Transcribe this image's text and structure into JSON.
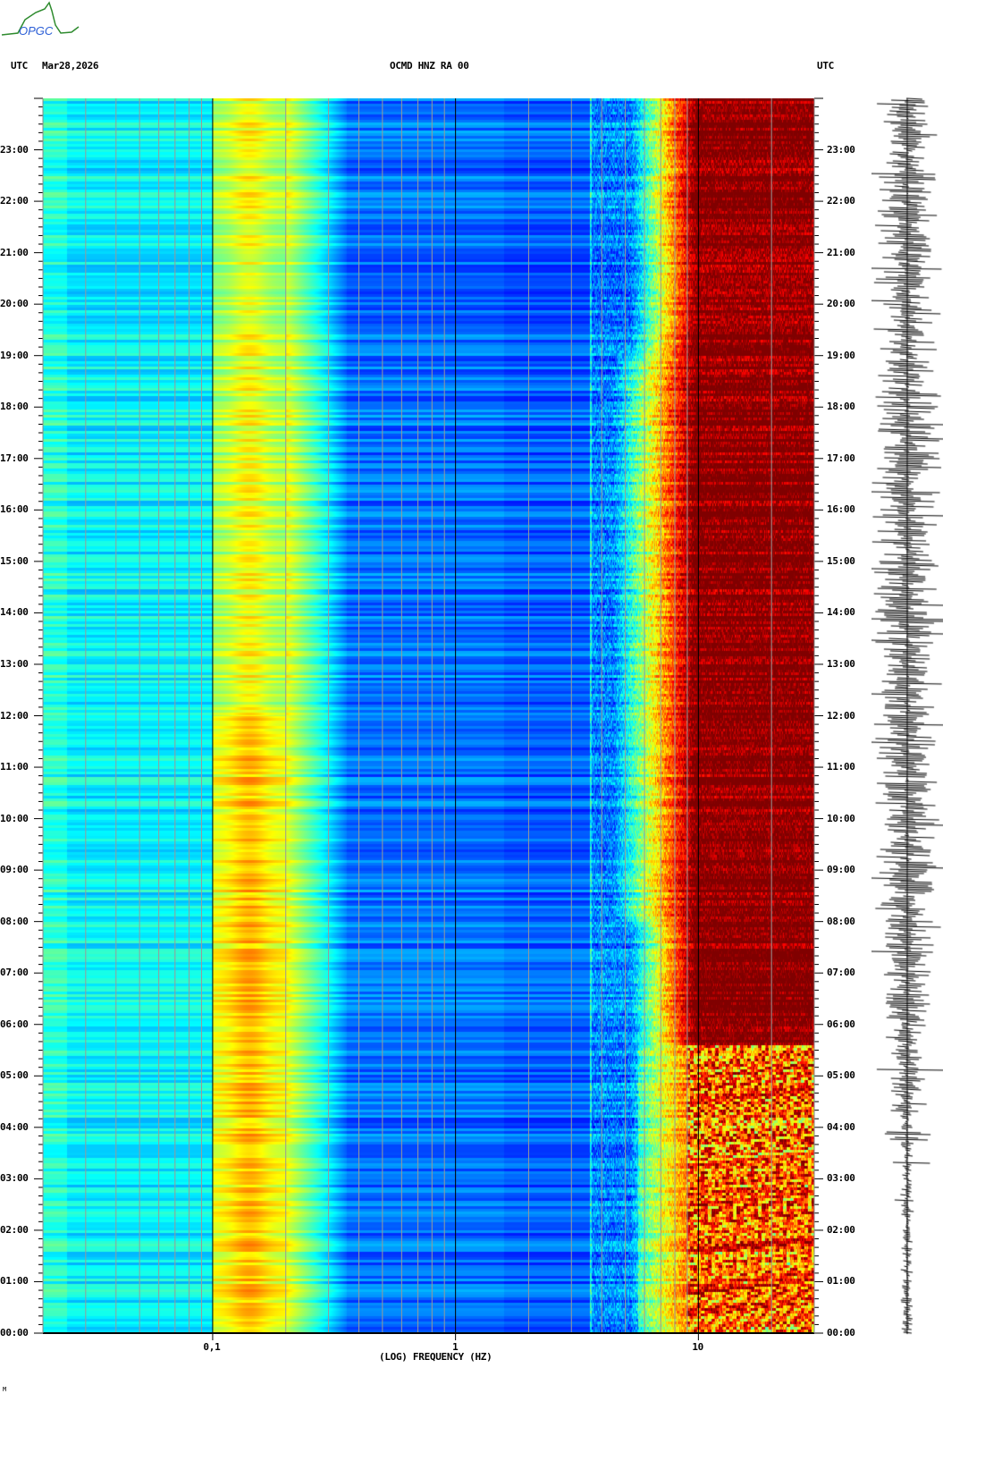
{
  "header": {
    "logo_text": "OPGC",
    "left_label": "UTC",
    "date": "Mar28,2026",
    "title": "OCMD HNZ RA 00",
    "right_label": "UTC"
  },
  "footer_mark": "M",
  "colors": {
    "low": "#00008f",
    "mid": "#00ffff",
    "high": "#ffff00",
    "max": "#800000"
  },
  "chart_data": {
    "type": "heatmap",
    "title": "OCMD HNZ RA 00",
    "xlabel": "(LOG) FREQUENCY (HZ)",
    "ylabel": "UTC",
    "x_scale": "log",
    "xlim": [
      0.02,
      30
    ],
    "x_ticks": [
      {
        "value": 0.1,
        "label": "0,1"
      },
      {
        "value": 1,
        "label": "1"
      },
      {
        "value": 10,
        "label": "10"
      }
    ],
    "ylim_hours": [
      0,
      24
    ],
    "y_ticks": [
      "00:00",
      "01:00",
      "02:00",
      "03:00",
      "04:00",
      "05:00",
      "06:00",
      "07:00",
      "08:00",
      "09:00",
      "10:00",
      "11:00",
      "12:00",
      "13:00",
      "14:00",
      "15:00",
      "16:00",
      "17:00",
      "18:00",
      "19:00",
      "20:00",
      "21:00",
      "22:00",
      "23:00"
    ],
    "colormap": "jet",
    "features": {
      "microseism_peak_hz": 0.14,
      "spectral_line_hz": 3.6,
      "high_noise_above_hz": 10,
      "quiet_hours": [
        0,
        5.5
      ]
    }
  }
}
